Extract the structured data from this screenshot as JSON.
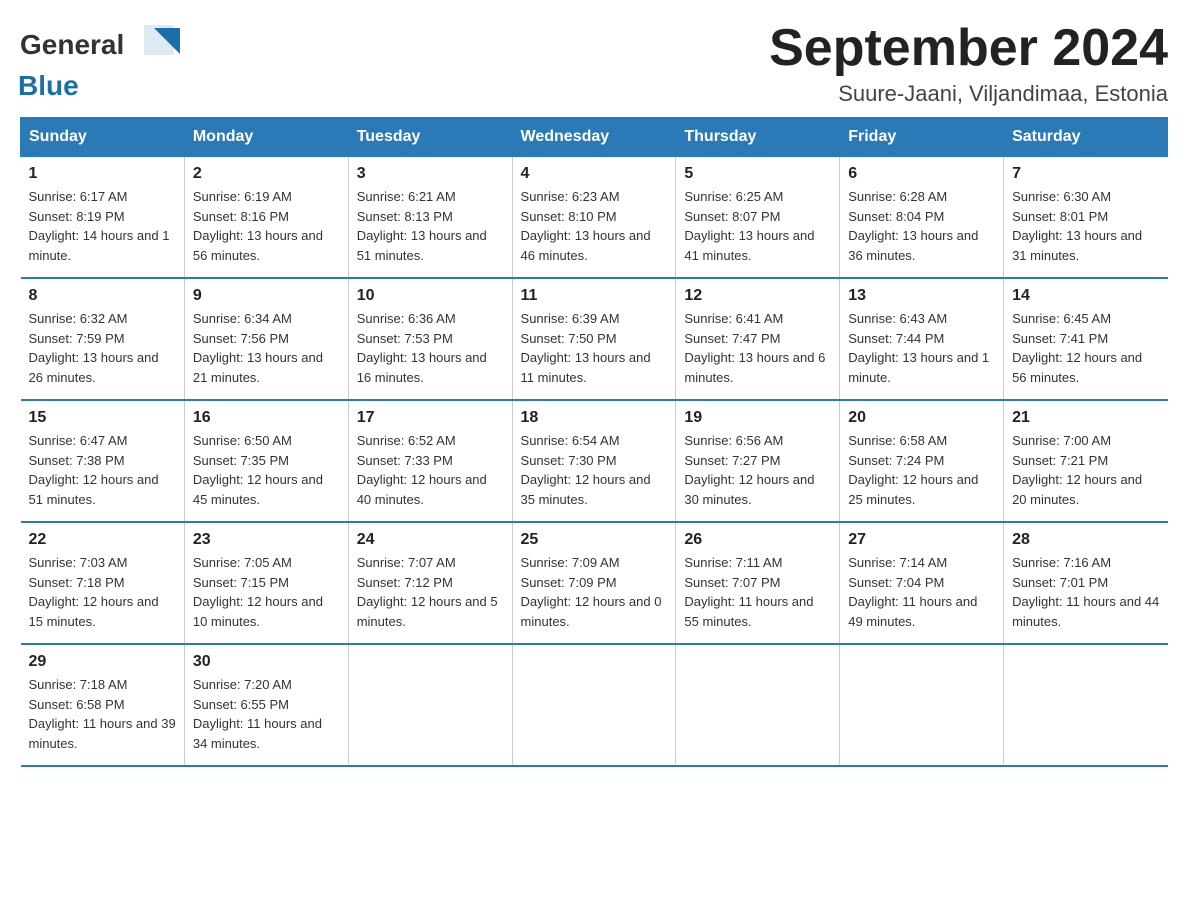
{
  "header": {
    "title": "September 2024",
    "subtitle": "Suure-Jaani, Viljandimaa, Estonia",
    "logo_general": "General",
    "logo_blue": "Blue"
  },
  "columns": [
    "Sunday",
    "Monday",
    "Tuesday",
    "Wednesday",
    "Thursday",
    "Friday",
    "Saturday"
  ],
  "weeks": [
    [
      {
        "day": "1",
        "sunrise": "Sunrise: 6:17 AM",
        "sunset": "Sunset: 8:19 PM",
        "daylight": "Daylight: 14 hours and 1 minute."
      },
      {
        "day": "2",
        "sunrise": "Sunrise: 6:19 AM",
        "sunset": "Sunset: 8:16 PM",
        "daylight": "Daylight: 13 hours and 56 minutes."
      },
      {
        "day": "3",
        "sunrise": "Sunrise: 6:21 AM",
        "sunset": "Sunset: 8:13 PM",
        "daylight": "Daylight: 13 hours and 51 minutes."
      },
      {
        "day": "4",
        "sunrise": "Sunrise: 6:23 AM",
        "sunset": "Sunset: 8:10 PM",
        "daylight": "Daylight: 13 hours and 46 minutes."
      },
      {
        "day": "5",
        "sunrise": "Sunrise: 6:25 AM",
        "sunset": "Sunset: 8:07 PM",
        "daylight": "Daylight: 13 hours and 41 minutes."
      },
      {
        "day": "6",
        "sunrise": "Sunrise: 6:28 AM",
        "sunset": "Sunset: 8:04 PM",
        "daylight": "Daylight: 13 hours and 36 minutes."
      },
      {
        "day": "7",
        "sunrise": "Sunrise: 6:30 AM",
        "sunset": "Sunset: 8:01 PM",
        "daylight": "Daylight: 13 hours and 31 minutes."
      }
    ],
    [
      {
        "day": "8",
        "sunrise": "Sunrise: 6:32 AM",
        "sunset": "Sunset: 7:59 PM",
        "daylight": "Daylight: 13 hours and 26 minutes."
      },
      {
        "day": "9",
        "sunrise": "Sunrise: 6:34 AM",
        "sunset": "Sunset: 7:56 PM",
        "daylight": "Daylight: 13 hours and 21 minutes."
      },
      {
        "day": "10",
        "sunrise": "Sunrise: 6:36 AM",
        "sunset": "Sunset: 7:53 PM",
        "daylight": "Daylight: 13 hours and 16 minutes."
      },
      {
        "day": "11",
        "sunrise": "Sunrise: 6:39 AM",
        "sunset": "Sunset: 7:50 PM",
        "daylight": "Daylight: 13 hours and 11 minutes."
      },
      {
        "day": "12",
        "sunrise": "Sunrise: 6:41 AM",
        "sunset": "Sunset: 7:47 PM",
        "daylight": "Daylight: 13 hours and 6 minutes."
      },
      {
        "day": "13",
        "sunrise": "Sunrise: 6:43 AM",
        "sunset": "Sunset: 7:44 PM",
        "daylight": "Daylight: 13 hours and 1 minute."
      },
      {
        "day": "14",
        "sunrise": "Sunrise: 6:45 AM",
        "sunset": "Sunset: 7:41 PM",
        "daylight": "Daylight: 12 hours and 56 minutes."
      }
    ],
    [
      {
        "day": "15",
        "sunrise": "Sunrise: 6:47 AM",
        "sunset": "Sunset: 7:38 PM",
        "daylight": "Daylight: 12 hours and 51 minutes."
      },
      {
        "day": "16",
        "sunrise": "Sunrise: 6:50 AM",
        "sunset": "Sunset: 7:35 PM",
        "daylight": "Daylight: 12 hours and 45 minutes."
      },
      {
        "day": "17",
        "sunrise": "Sunrise: 6:52 AM",
        "sunset": "Sunset: 7:33 PM",
        "daylight": "Daylight: 12 hours and 40 minutes."
      },
      {
        "day": "18",
        "sunrise": "Sunrise: 6:54 AM",
        "sunset": "Sunset: 7:30 PM",
        "daylight": "Daylight: 12 hours and 35 minutes."
      },
      {
        "day": "19",
        "sunrise": "Sunrise: 6:56 AM",
        "sunset": "Sunset: 7:27 PM",
        "daylight": "Daylight: 12 hours and 30 minutes."
      },
      {
        "day": "20",
        "sunrise": "Sunrise: 6:58 AM",
        "sunset": "Sunset: 7:24 PM",
        "daylight": "Daylight: 12 hours and 25 minutes."
      },
      {
        "day": "21",
        "sunrise": "Sunrise: 7:00 AM",
        "sunset": "Sunset: 7:21 PM",
        "daylight": "Daylight: 12 hours and 20 minutes."
      }
    ],
    [
      {
        "day": "22",
        "sunrise": "Sunrise: 7:03 AM",
        "sunset": "Sunset: 7:18 PM",
        "daylight": "Daylight: 12 hours and 15 minutes."
      },
      {
        "day": "23",
        "sunrise": "Sunrise: 7:05 AM",
        "sunset": "Sunset: 7:15 PM",
        "daylight": "Daylight: 12 hours and 10 minutes."
      },
      {
        "day": "24",
        "sunrise": "Sunrise: 7:07 AM",
        "sunset": "Sunset: 7:12 PM",
        "daylight": "Daylight: 12 hours and 5 minutes."
      },
      {
        "day": "25",
        "sunrise": "Sunrise: 7:09 AM",
        "sunset": "Sunset: 7:09 PM",
        "daylight": "Daylight: 12 hours and 0 minutes."
      },
      {
        "day": "26",
        "sunrise": "Sunrise: 7:11 AM",
        "sunset": "Sunset: 7:07 PM",
        "daylight": "Daylight: 11 hours and 55 minutes."
      },
      {
        "day": "27",
        "sunrise": "Sunrise: 7:14 AM",
        "sunset": "Sunset: 7:04 PM",
        "daylight": "Daylight: 11 hours and 49 minutes."
      },
      {
        "day": "28",
        "sunrise": "Sunrise: 7:16 AM",
        "sunset": "Sunset: 7:01 PM",
        "daylight": "Daylight: 11 hours and 44 minutes."
      }
    ],
    [
      {
        "day": "29",
        "sunrise": "Sunrise: 7:18 AM",
        "sunset": "Sunset: 6:58 PM",
        "daylight": "Daylight: 11 hours and 39 minutes."
      },
      {
        "day": "30",
        "sunrise": "Sunrise: 7:20 AM",
        "sunset": "Sunset: 6:55 PM",
        "daylight": "Daylight: 11 hours and 34 minutes."
      },
      null,
      null,
      null,
      null,
      null
    ]
  ]
}
